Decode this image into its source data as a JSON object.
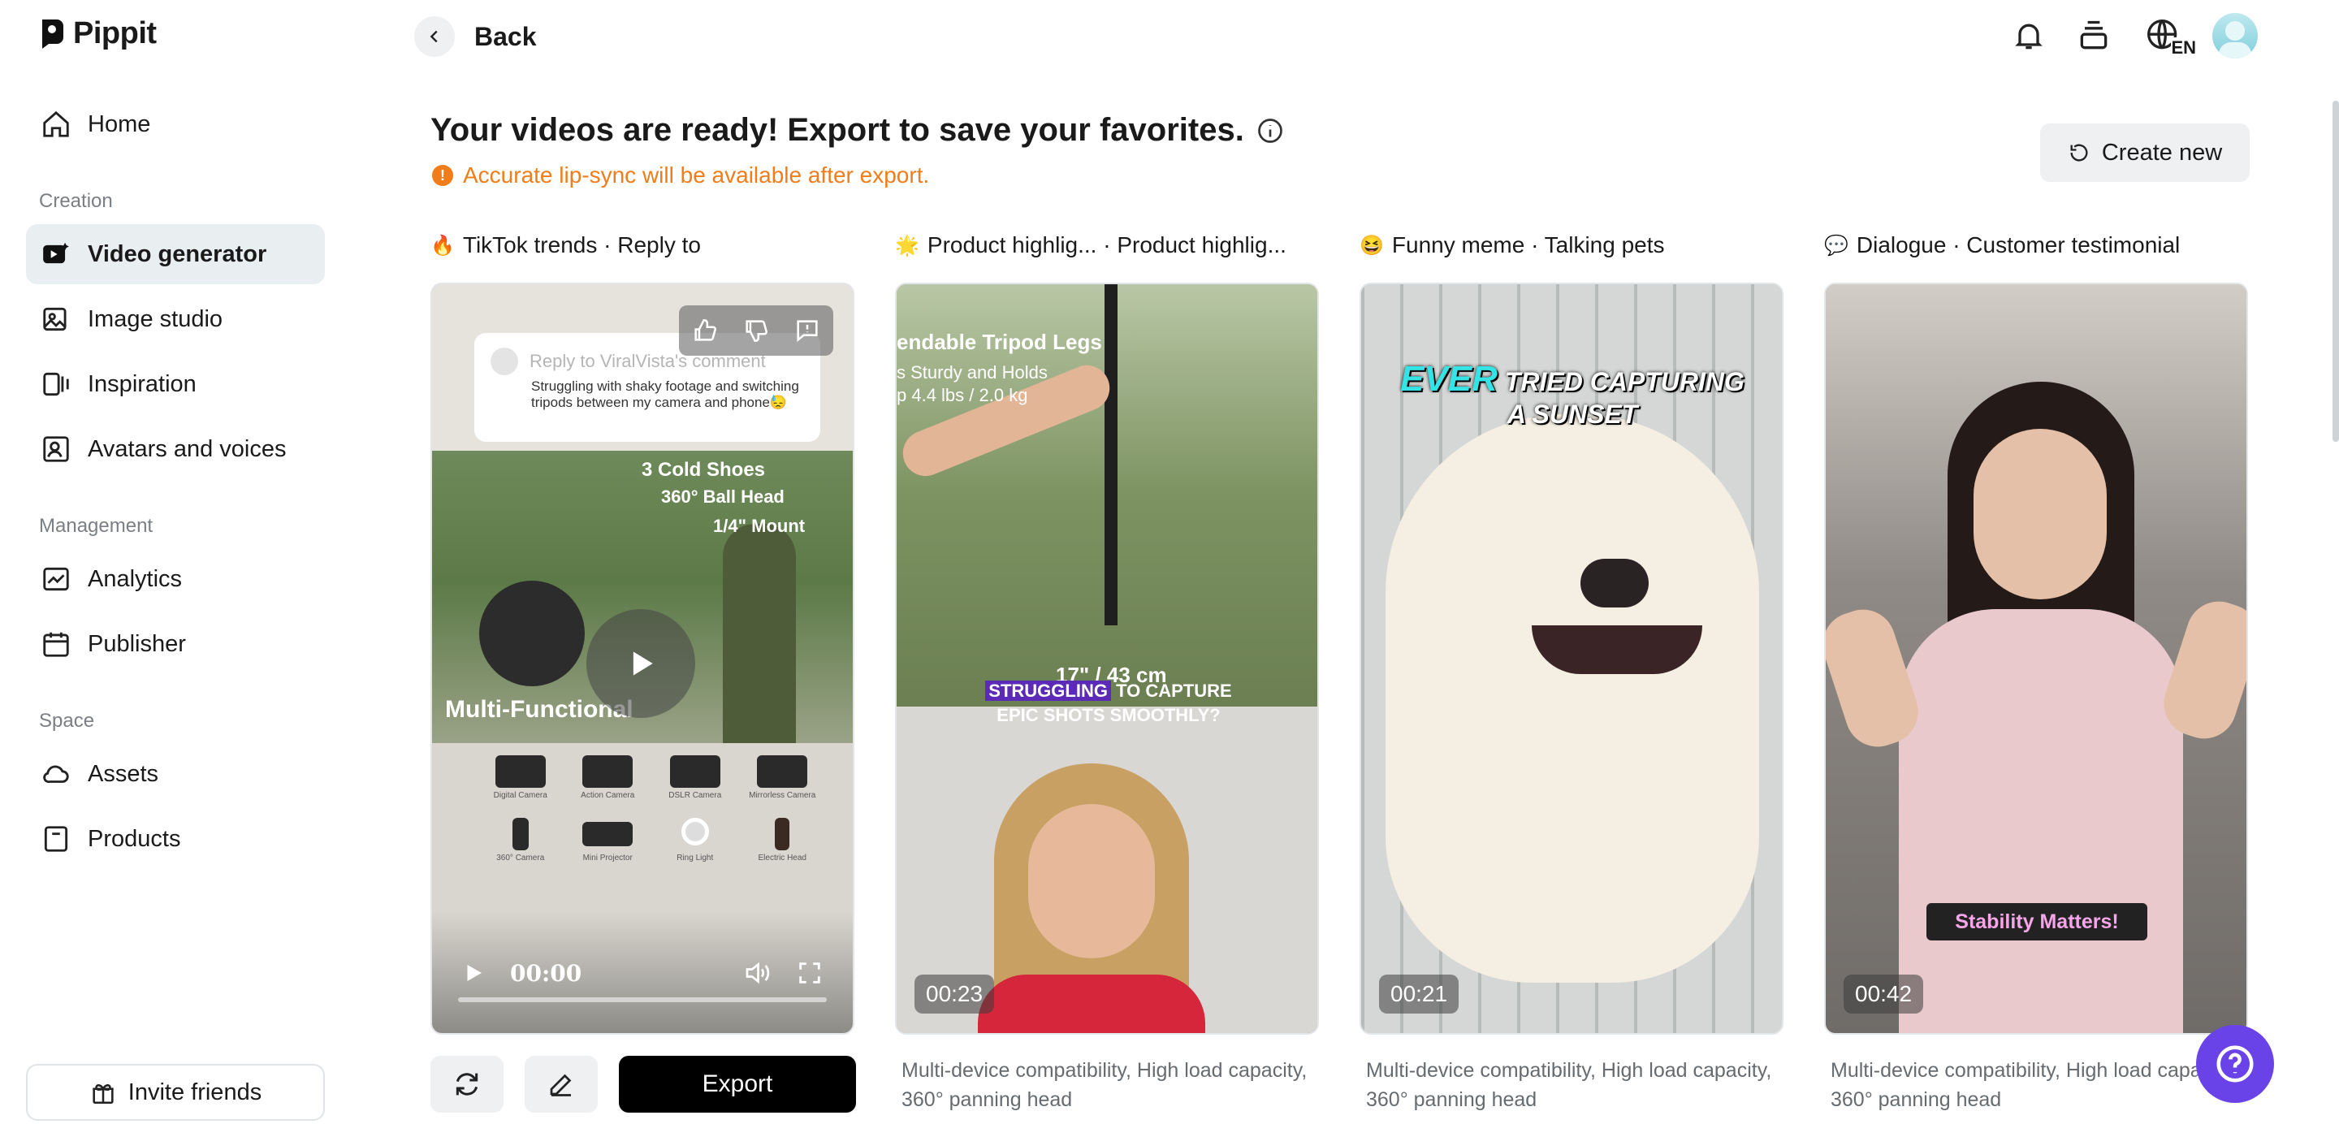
{
  "brand": {
    "name": "Pippit"
  },
  "sidebar": {
    "items": [
      {
        "label": "Home",
        "icon": "home-icon"
      },
      {
        "label": "Video generator",
        "icon": "video-generator-icon",
        "active": true
      },
      {
        "label": "Image studio",
        "icon": "image-studio-icon"
      },
      {
        "label": "Inspiration",
        "icon": "inspiration-icon"
      },
      {
        "label": "Avatars and voices",
        "icon": "avatar-voice-icon"
      },
      {
        "label": "Analytics",
        "icon": "analytics-icon"
      },
      {
        "label": "Publisher",
        "icon": "calendar-icon"
      },
      {
        "label": "Assets",
        "icon": "cloud-icon"
      },
      {
        "label": "Products",
        "icon": "box-icon"
      }
    ],
    "sections": {
      "creation": "Creation",
      "management": "Management",
      "space": "Space"
    },
    "invite_label": "Invite friends"
  },
  "header": {
    "back_label": "Back",
    "language": "EN"
  },
  "main": {
    "headline": "Your videos are ready! Export to save your favorites.",
    "warning": "Accurate lip-sync will be available after export.",
    "create_new_label": "Create new",
    "export_label": "Export",
    "columns": [
      {
        "emoji": "🔥",
        "title": "TikTok trends · Reply to",
        "description": ""
      },
      {
        "emoji": "🌟",
        "title": "Product highlig...  · Product highlig...",
        "duration": "00:23",
        "description": "Multi-device compatibility, High load capacity, 360° panning head"
      },
      {
        "emoji": "😆",
        "title": "Funny meme · Talking pets",
        "duration": "00:21",
        "description": "Multi-device compatibility, High load capacity, 360° panning head"
      },
      {
        "emoji": "💬",
        "title": "Dialogue · Customer testimonial",
        "duration": "00:42",
        "description": "Multi-device compatibility, High load capacity, 360° panning head"
      }
    ],
    "player": {
      "time": "00:00",
      "comment_header": "Reply to ViralVista's comment",
      "comment_body": "Struggling with shaky footage and switching tripods between my camera and phone😓",
      "overlay_lines": [
        "3 Cold Shoes",
        "360° Ball Head",
        "1/4\" Mount"
      ],
      "overlay_title": "Multi-Functional",
      "devices": [
        "Digital Camera",
        "Action Camera",
        "DSLR Camera",
        "Mirrorless Camera",
        "360° Camera",
        "Mini Projector",
        "Ring Light",
        "Electric Head"
      ]
    },
    "card2_overlay": {
      "top": "endable Tripod Legs",
      "sub1": "s Sturdy and Holds",
      "sub2": "p 4.4 lbs / 2.0 kg",
      "measure": "17\" / 43 cm",
      "caption_hl": "STRUGGLING",
      "caption": "TO CAPTURE EPIC SHOTS SMOOTHLY?"
    },
    "card3_overlay": {
      "hl": "EVER",
      "caption": "TRIED CAPTURING A SUNSET"
    },
    "card4_overlay": {
      "caption": "Stability Matters!"
    }
  },
  "colors": {
    "accent_orange": "#f07c1a",
    "help_purple": "#6a43e8",
    "active_bg": "#e9eef1"
  }
}
